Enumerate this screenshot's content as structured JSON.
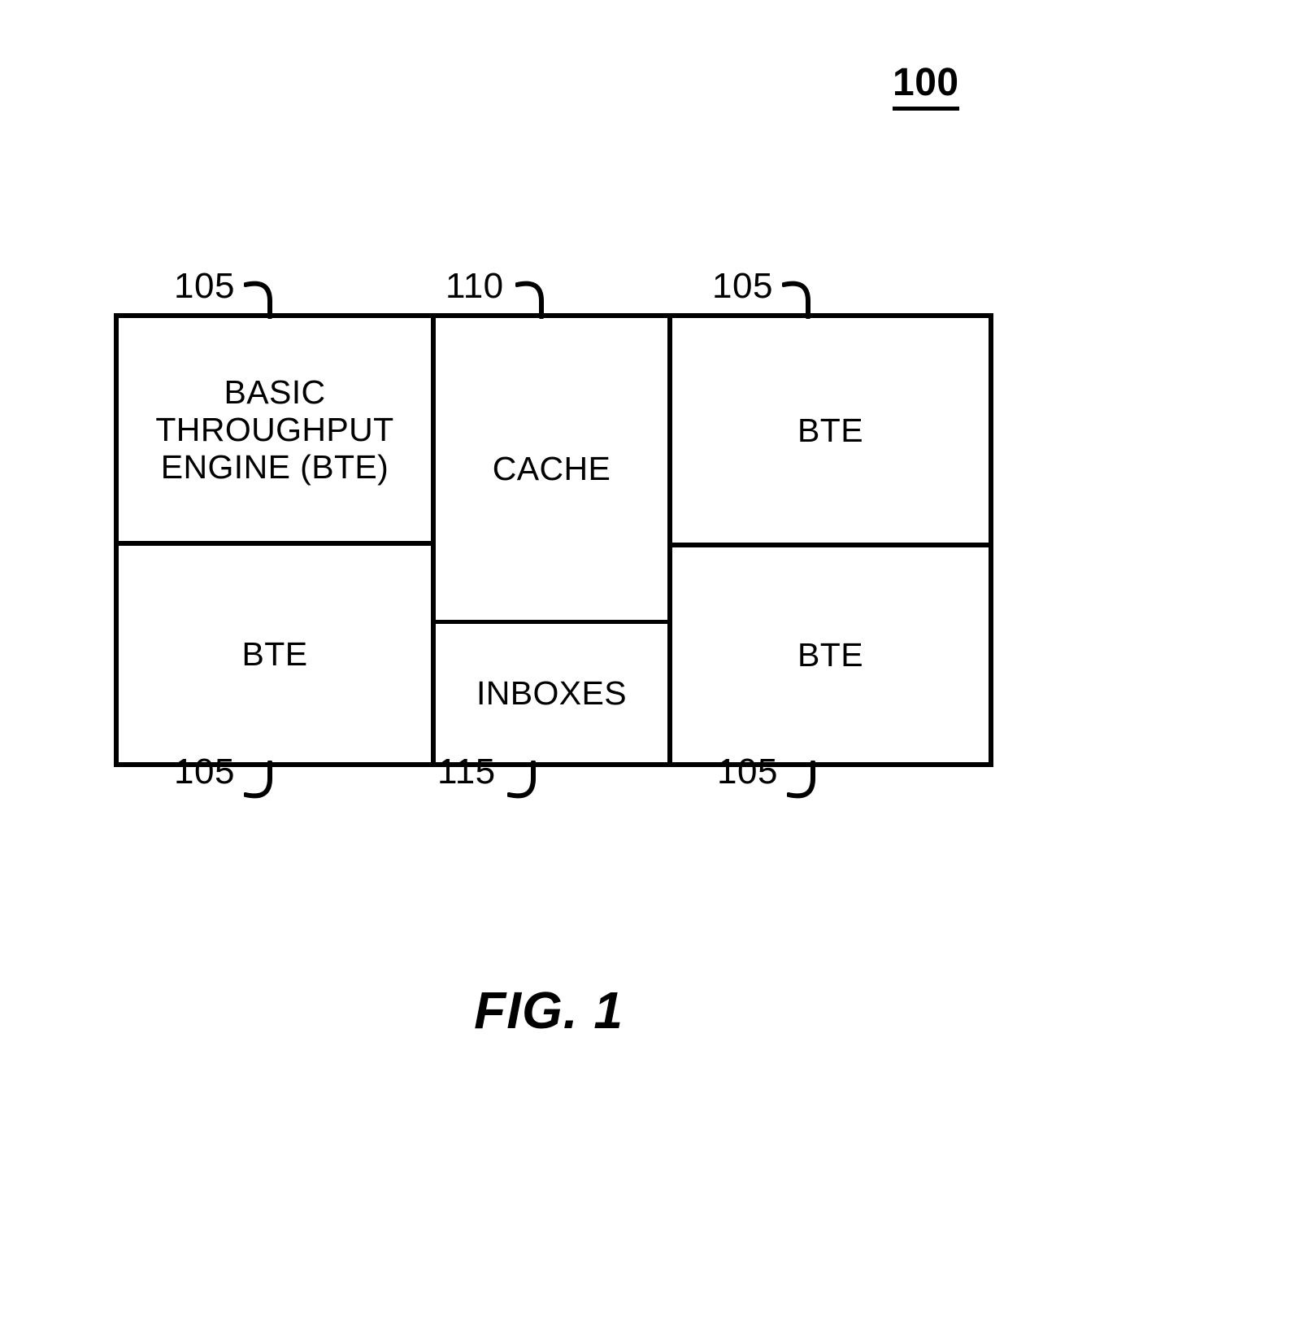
{
  "figure": {
    "number_label": "100",
    "caption": "FIG. 1"
  },
  "diagram": {
    "left_column": {
      "top_cell": {
        "label": "BASIC\nTHROUGHPUT\nENGINE (BTE)",
        "ref": "105"
      },
      "bottom_cell": {
        "label": "BTE",
        "ref": "105"
      }
    },
    "center_column": {
      "top_cell": {
        "label": "CACHE",
        "ref": "110"
      },
      "bottom_cell": {
        "label": "INBOXES",
        "ref": "115"
      }
    },
    "right_column": {
      "top_cell": {
        "label": "BTE",
        "ref": "105"
      },
      "bottom_cell": {
        "label": "BTE",
        "ref": "105"
      }
    }
  },
  "callouts": {
    "top_left": "105",
    "top_center": "110",
    "top_right": "105",
    "bottom_left": "105",
    "bottom_center": "115",
    "bottom_right": "105"
  },
  "colors": {
    "ink": "#000000",
    "paper": "#ffffff"
  }
}
